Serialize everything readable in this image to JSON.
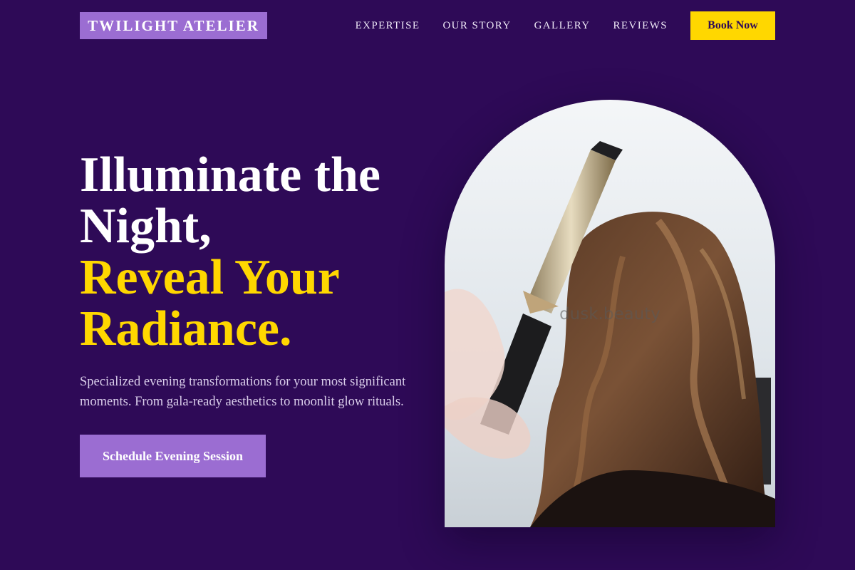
{
  "brand": {
    "name": "TWILIGHT ATELIER"
  },
  "nav": {
    "links": [
      "EXPERTISE",
      "OUR STORY",
      "GALLERY",
      "REVIEWS"
    ],
    "cta_label": "Book Now"
  },
  "hero": {
    "headline_line1": "Illuminate the",
    "headline_line2": "Night,",
    "headline_line3": "Reveal Your",
    "headline_line4": "Radiance.",
    "description": "Specialized evening transformations for your most significant moments. From gala-ready aesthetics to moonlit glow rituals.",
    "cta_label": "Schedule Evening Session",
    "image_watermark": "dusk.beauty"
  },
  "colors": {
    "background": "#2e0a57",
    "accent_purple": "#9b6dd2",
    "accent_gold": "#ffd700"
  }
}
